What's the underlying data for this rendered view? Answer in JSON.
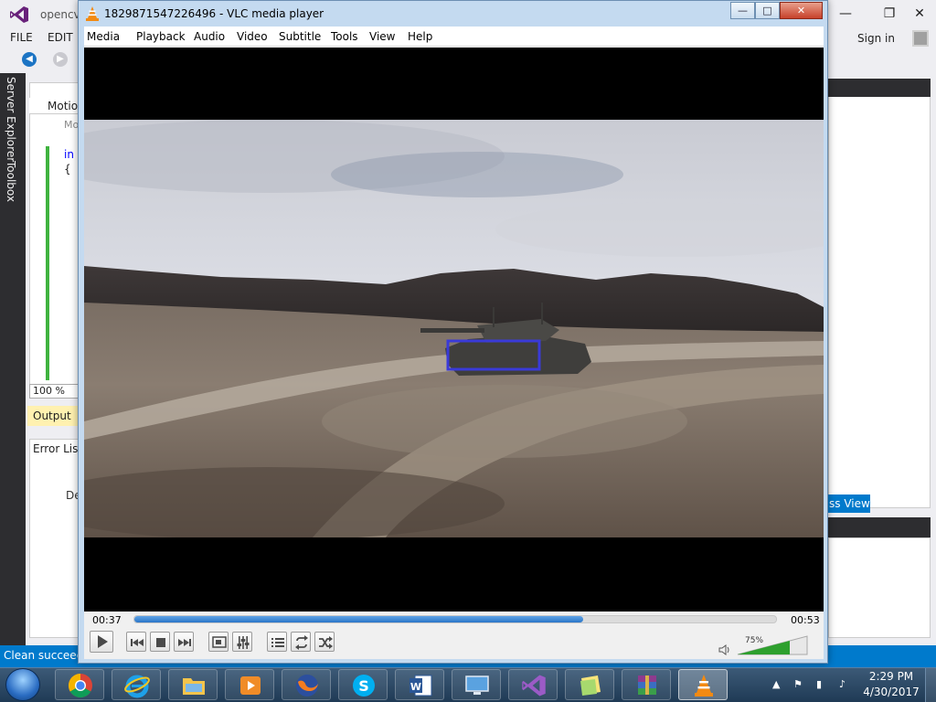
{
  "vs": {
    "title": "opencv",
    "menu": [
      "FILE",
      "EDIT"
    ],
    "sign_in": "Sign in",
    "side_tabs": [
      "Server Explorer",
      "Toolbox"
    ],
    "editor_tab": "Motio",
    "code_line1": "Mo",
    "code_line2": "in",
    "code_line3": "{",
    "zoom": "100 %",
    "output_tab": "Output",
    "error_list": "Error List",
    "error_col": "De",
    "class_view": "ss View",
    "status": "Clean succeede"
  },
  "vlc": {
    "title": "1829871547226496 - VLC media player",
    "menu": [
      "Media",
      "Playback",
      "Audio",
      "Video",
      "Subtitle",
      "Tools",
      "View",
      "Help"
    ],
    "time_elapsed": "00:37",
    "time_total": "00:53",
    "progress": 0.7,
    "volume_label": "75%",
    "volume": 0.75,
    "window_buttons": [
      "minimize",
      "maximize",
      "close"
    ],
    "colors": {
      "seek": "#2a75c7",
      "volume": "#2ea02e",
      "tracking_box": "#3a3ad8"
    }
  },
  "taskbar": {
    "items": [
      "chrome",
      "internet-explorer",
      "file-explorer",
      "media-player",
      "firefox",
      "skype",
      "word",
      "remote-desktop",
      "visual-studio",
      "sticky-notes",
      "winrar",
      "vlc"
    ],
    "time": "2:29 PM",
    "date": "4/30/2017"
  }
}
